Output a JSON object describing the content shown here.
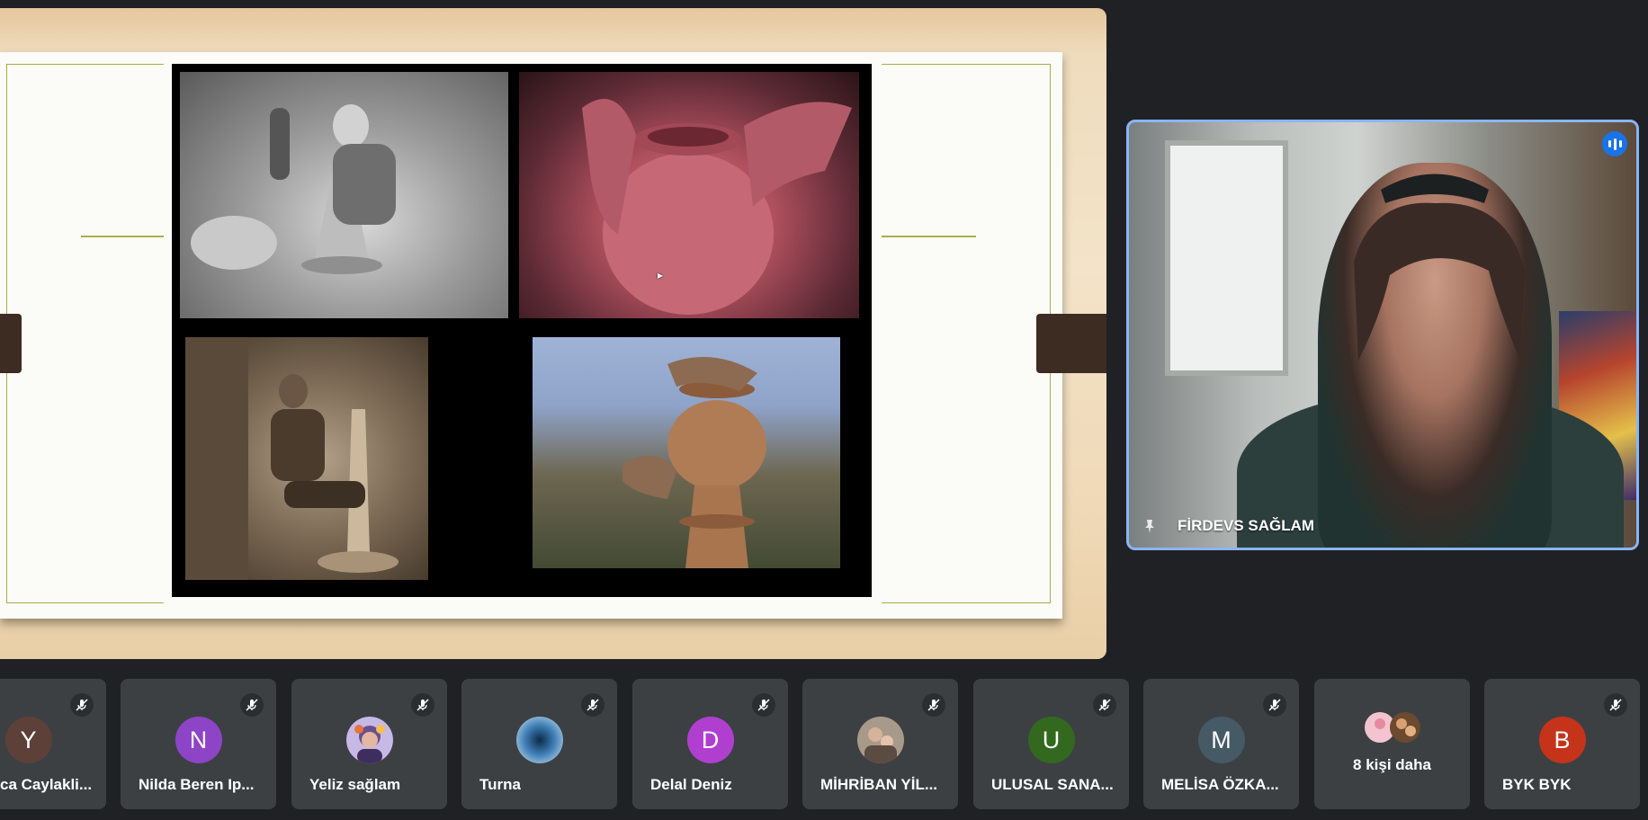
{
  "speaker": {
    "name": "FİRDEVS SAĞLAM",
    "pin_icon": "pin-icon",
    "audio_icon": "audio-level-icon"
  },
  "presentation": {
    "photos": [
      "potter-old-man-photo",
      "pink-clay-hands-photo",
      "potter-man-photo",
      "brown-clay-pot-photo"
    ]
  },
  "participants": [
    {
      "name": "ca Caylakli...",
      "initial": "Y",
      "color": "#5d4037",
      "muted": true
    },
    {
      "name": "Nilda Beren Ip...",
      "initial": "N",
      "color": "#8e44c7",
      "muted": true
    },
    {
      "name": "Yeliz sağlam",
      "initial": "",
      "color": "#6f5aa8",
      "muted": true,
      "photo": true
    },
    {
      "name": "Turna",
      "initial": "",
      "color": "#1b5d8f",
      "muted": true,
      "photo": true
    },
    {
      "name": "Delal Deniz",
      "initial": "D",
      "color": "#b03fd0",
      "muted": true
    },
    {
      "name": "MİHRİBAN YİL...",
      "initial": "",
      "color": "#8a7b6e",
      "muted": true,
      "photo": true
    },
    {
      "name": "ULUSAL SANA...",
      "initial": "U",
      "color": "#33691e",
      "muted": true
    },
    {
      "name": "MELİSA ÖZKA...",
      "initial": "M",
      "color": "#455a64",
      "muted": true
    },
    {
      "name": "8 kişi daha",
      "initial": "",
      "color": "",
      "muted": false,
      "group": true
    },
    {
      "name": "BYK BYK",
      "initial": "B",
      "color": "#c5331a",
      "muted": true
    }
  ],
  "colors": {
    "background": "#202124",
    "tile": "#3c4043",
    "accent": "#8ab4f8"
  }
}
